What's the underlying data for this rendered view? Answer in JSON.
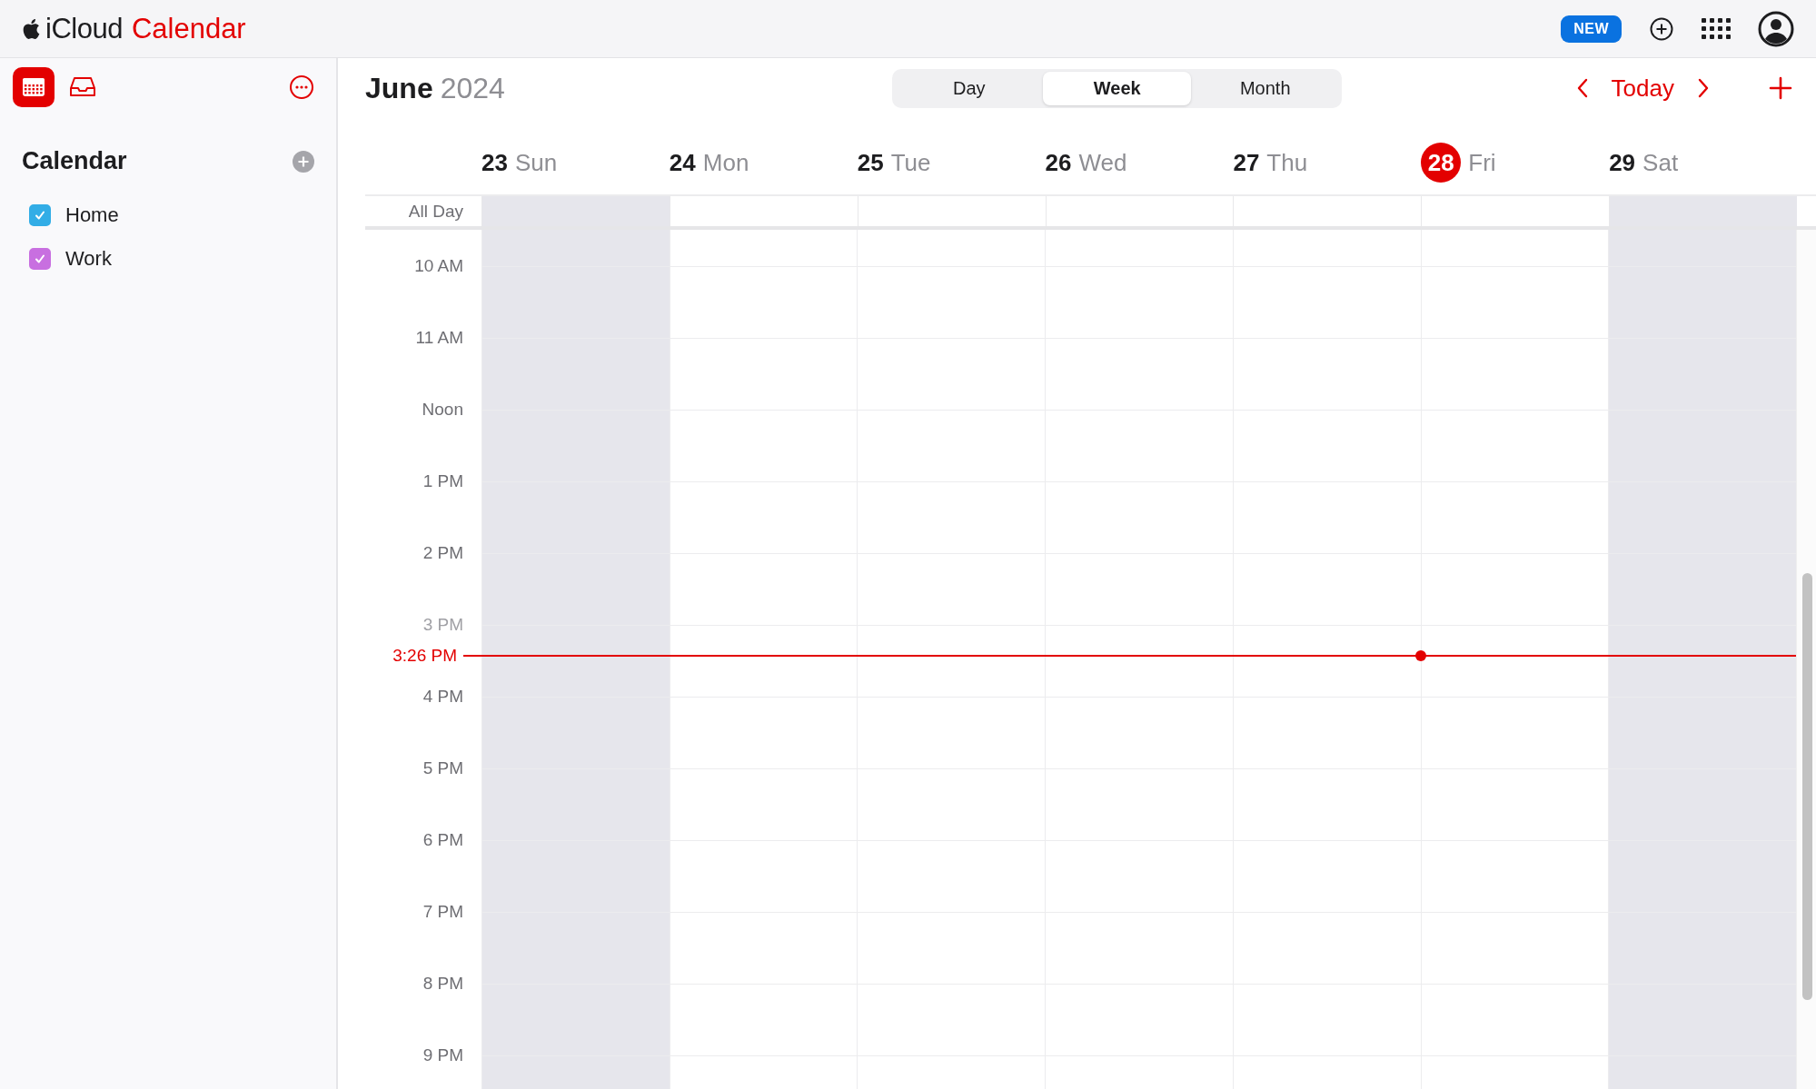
{
  "app": {
    "brand": "iCloud",
    "title": "Calendar"
  },
  "header": {
    "badge": "NEW"
  },
  "sidebar": {
    "section_title": "Calendar",
    "calendars": [
      {
        "name": "Home",
        "checked": true,
        "color": "#32ade6"
      },
      {
        "name": "Work",
        "checked": true,
        "color": "#c86fe0"
      }
    ]
  },
  "toolbar": {
    "month": "June",
    "year": "2024",
    "views": [
      {
        "label": "Day",
        "selected": false
      },
      {
        "label": "Week",
        "selected": true
      },
      {
        "label": "Month",
        "selected": false
      }
    ],
    "today": "Today"
  },
  "week": {
    "days": [
      {
        "date": "23",
        "weekday": "Sun",
        "today": false,
        "weekend": true
      },
      {
        "date": "24",
        "weekday": "Mon",
        "today": false,
        "weekend": false
      },
      {
        "date": "25",
        "weekday": "Tue",
        "today": false,
        "weekend": false
      },
      {
        "date": "26",
        "weekday": "Wed",
        "today": false,
        "weekend": false
      },
      {
        "date": "27",
        "weekday": "Thu",
        "today": false,
        "weekend": false
      },
      {
        "date": "28",
        "weekday": "Fri",
        "today": true,
        "weekend": false
      },
      {
        "date": "29",
        "weekday": "Sat",
        "today": false,
        "weekend": true
      }
    ],
    "all_day_label": "All Day",
    "hours": [
      {
        "label": "10 AM",
        "kind": "hour"
      },
      {
        "label": "11 AM",
        "kind": "hour"
      },
      {
        "label": "Noon",
        "kind": "hour"
      },
      {
        "label": "1 PM",
        "kind": "hour"
      },
      {
        "label": "2 PM",
        "kind": "hour"
      },
      {
        "label": "3 PM",
        "kind": "hour"
      },
      {
        "label": "3:26 PM",
        "kind": "now"
      },
      {
        "label": "4 PM",
        "kind": "hour"
      },
      {
        "label": "5 PM",
        "kind": "hour"
      },
      {
        "label": "6 PM",
        "kind": "hour"
      },
      {
        "label": "7 PM",
        "kind": "hour"
      },
      {
        "label": "8 PM",
        "kind": "hour"
      },
      {
        "label": "9 PM",
        "kind": "hour"
      }
    ]
  }
}
